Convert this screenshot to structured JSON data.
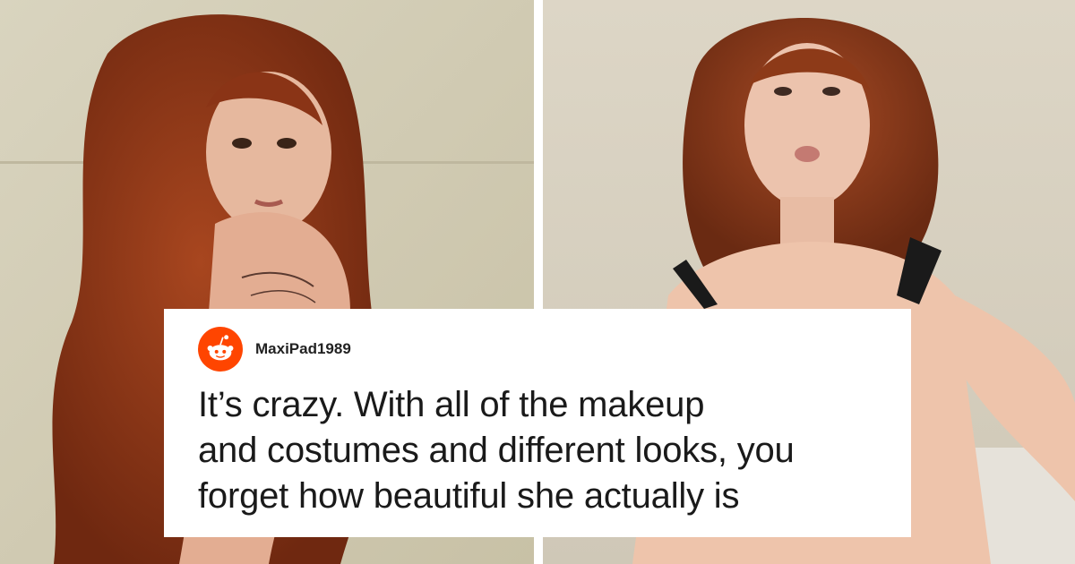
{
  "images": {
    "left_photo": {
      "description_icon": "portrait-photo-icon"
    },
    "right_photo": {
      "description_icon": "portrait-photo-icon"
    }
  },
  "comment": {
    "avatar_icon": "reddit-snoo-icon",
    "avatar_color": "#FF4500",
    "username": "MaxiPad1989",
    "text": "It’s crazy. With all of the makeup\nand costumes and different looks, you\nforget how beautiful she actually is"
  }
}
